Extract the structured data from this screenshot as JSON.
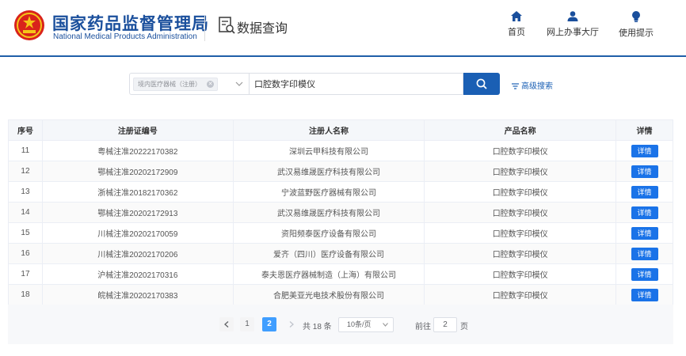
{
  "header": {
    "brand_cn": "国家药品监督管理局",
    "brand_en": "National Medical Products Administration",
    "query_title": "数据查询",
    "nav": [
      {
        "label": "首页",
        "icon": "home-icon"
      },
      {
        "label": "网上办事大厅",
        "icon": "user-icon"
      },
      {
        "label": "使用提示",
        "icon": "bulb-icon"
      }
    ],
    "brand_color": "#1a4f9c"
  },
  "search": {
    "category_tag": "境内医疗器械（注册）",
    "query_value": "口腔数字印模仪",
    "advanced_label": "高级搜索"
  },
  "table": {
    "headers": [
      "序号",
      "注册证编号",
      "注册人名称",
      "产品名称",
      "详情"
    ],
    "rows": [
      {
        "no": "11",
        "cert": "粤械注准20222170382",
        "registrant": "深圳云甲科技有限公司",
        "product": "口腔数字印模仪",
        "detail": "详情"
      },
      {
        "no": "12",
        "cert": "鄂械注准20202172909",
        "registrant": "武汉易维晟医疗科技有限公司",
        "product": "口腔数字印模仪",
        "detail": "详情"
      },
      {
        "no": "13",
        "cert": "浙械注准20182170362",
        "registrant": "宁波蓝野医疗器械有限公司",
        "product": "口腔数字印模仪",
        "detail": "详情"
      },
      {
        "no": "14",
        "cert": "鄂械注准20202172913",
        "registrant": "武汉易维晟医疗科技有限公司",
        "product": "口腔数字印模仪",
        "detail": "详情"
      },
      {
        "no": "15",
        "cert": "川械注准20202170059",
        "registrant": "资阳频泰医疗设备有限公司",
        "product": "口腔数字印模仪",
        "detail": "详情"
      },
      {
        "no": "16",
        "cert": "川械注准20202170206",
        "registrant": "爱齐（四川）医疗设备有限公司",
        "product": "口腔数字印模仪",
        "detail": "详情"
      },
      {
        "no": "17",
        "cert": "沪械注准20202170316",
        "registrant": "泰夫恩医疗器械制造（上海）有限公司",
        "product": "口腔数字印模仪",
        "detail": "详情"
      },
      {
        "no": "18",
        "cert": "皖械注准20202170383",
        "registrant": "合肥美亚光电技术股份有限公司",
        "product": "口腔数字印模仪",
        "detail": "详情"
      }
    ]
  },
  "pagination": {
    "pages": [
      "1",
      "2"
    ],
    "current_page": "2",
    "total": "共 18 条",
    "page_size": "10条/页",
    "goto_label": "前往",
    "goto_value": "2",
    "page_unit": "页"
  }
}
